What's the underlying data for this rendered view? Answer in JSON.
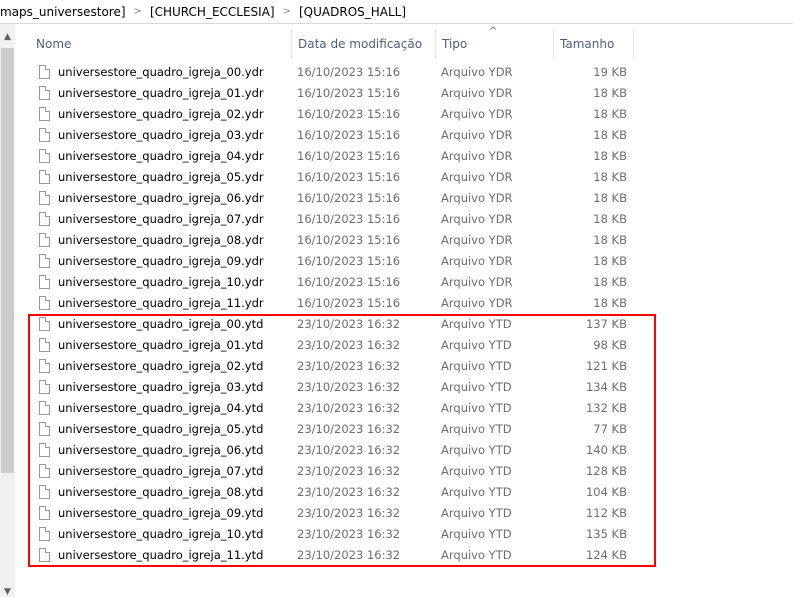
{
  "breadcrumb": [
    "maps_universestore]",
    "[CHURCH_ECCLESIA]",
    "[QUADROS_HALL]"
  ],
  "columns": {
    "name": "Nome",
    "date": "Data de modificação",
    "type": "Tipo",
    "size": "Tamanho"
  },
  "highlight_color": "#ff0000",
  "files": [
    {
      "name": "universestore_quadro_igreja_00.ydr",
      "date": "16/10/2023 15:16",
      "type": "Arquivo YDR",
      "size": "19 KB"
    },
    {
      "name": "universestore_quadro_igreja_01.ydr",
      "date": "16/10/2023 15:16",
      "type": "Arquivo YDR",
      "size": "18 KB"
    },
    {
      "name": "universestore_quadro_igreja_02.ydr",
      "date": "16/10/2023 15:16",
      "type": "Arquivo YDR",
      "size": "18 KB"
    },
    {
      "name": "universestore_quadro_igreja_03.ydr",
      "date": "16/10/2023 15:16",
      "type": "Arquivo YDR",
      "size": "18 KB"
    },
    {
      "name": "universestore_quadro_igreja_04.ydr",
      "date": "16/10/2023 15:16",
      "type": "Arquivo YDR",
      "size": "18 KB"
    },
    {
      "name": "universestore_quadro_igreja_05.ydr",
      "date": "16/10/2023 15:16",
      "type": "Arquivo YDR",
      "size": "18 KB"
    },
    {
      "name": "universestore_quadro_igreja_06.ydr",
      "date": "16/10/2023 15:16",
      "type": "Arquivo YDR",
      "size": "18 KB"
    },
    {
      "name": "universestore_quadro_igreja_07.ydr",
      "date": "16/10/2023 15:16",
      "type": "Arquivo YDR",
      "size": "18 KB"
    },
    {
      "name": "universestore_quadro_igreja_08.ydr",
      "date": "16/10/2023 15:16",
      "type": "Arquivo YDR",
      "size": "18 KB"
    },
    {
      "name": "universestore_quadro_igreja_09.ydr",
      "date": "16/10/2023 15:16",
      "type": "Arquivo YDR",
      "size": "18 KB"
    },
    {
      "name": "universestore_quadro_igreja_10.ydr",
      "date": "16/10/2023 15:16",
      "type": "Arquivo YDR",
      "size": "18 KB"
    },
    {
      "name": "universestore_quadro_igreja_11.ydr",
      "date": "16/10/2023 15:16",
      "type": "Arquivo YDR",
      "size": "18 KB"
    },
    {
      "name": "universestore_quadro_igreja_00.ytd",
      "date": "23/10/2023 16:32",
      "type": "Arquivo YTD",
      "size": "137 KB"
    },
    {
      "name": "universestore_quadro_igreja_01.ytd",
      "date": "23/10/2023 16:32",
      "type": "Arquivo YTD",
      "size": "98 KB"
    },
    {
      "name": "universestore_quadro_igreja_02.ytd",
      "date": "23/10/2023 16:32",
      "type": "Arquivo YTD",
      "size": "121 KB"
    },
    {
      "name": "universestore_quadro_igreja_03.ytd",
      "date": "23/10/2023 16:32",
      "type": "Arquivo YTD",
      "size": "134 KB"
    },
    {
      "name": "universestore_quadro_igreja_04.ytd",
      "date": "23/10/2023 16:32",
      "type": "Arquivo YTD",
      "size": "132 KB"
    },
    {
      "name": "universestore_quadro_igreja_05.ytd",
      "date": "23/10/2023 16:32",
      "type": "Arquivo YTD",
      "size": "77 KB"
    },
    {
      "name": "universestore_quadro_igreja_06.ytd",
      "date": "23/10/2023 16:32",
      "type": "Arquivo YTD",
      "size": "140 KB"
    },
    {
      "name": "universestore_quadro_igreja_07.ytd",
      "date": "23/10/2023 16:32",
      "type": "Arquivo YTD",
      "size": "128 KB"
    },
    {
      "name": "universestore_quadro_igreja_08.ytd",
      "date": "23/10/2023 16:32",
      "type": "Arquivo YTD",
      "size": "104 KB"
    },
    {
      "name": "universestore_quadro_igreja_09.ytd",
      "date": "23/10/2023 16:32",
      "type": "Arquivo YTD",
      "size": "112 KB"
    },
    {
      "name": "universestore_quadro_igreja_10.ytd",
      "date": "23/10/2023 16:32",
      "type": "Arquivo YTD",
      "size": "135 KB"
    },
    {
      "name": "universestore_quadro_igreja_11.ytd",
      "date": "23/10/2023 16:32",
      "type": "Arquivo YTD",
      "size": "124 KB"
    }
  ]
}
